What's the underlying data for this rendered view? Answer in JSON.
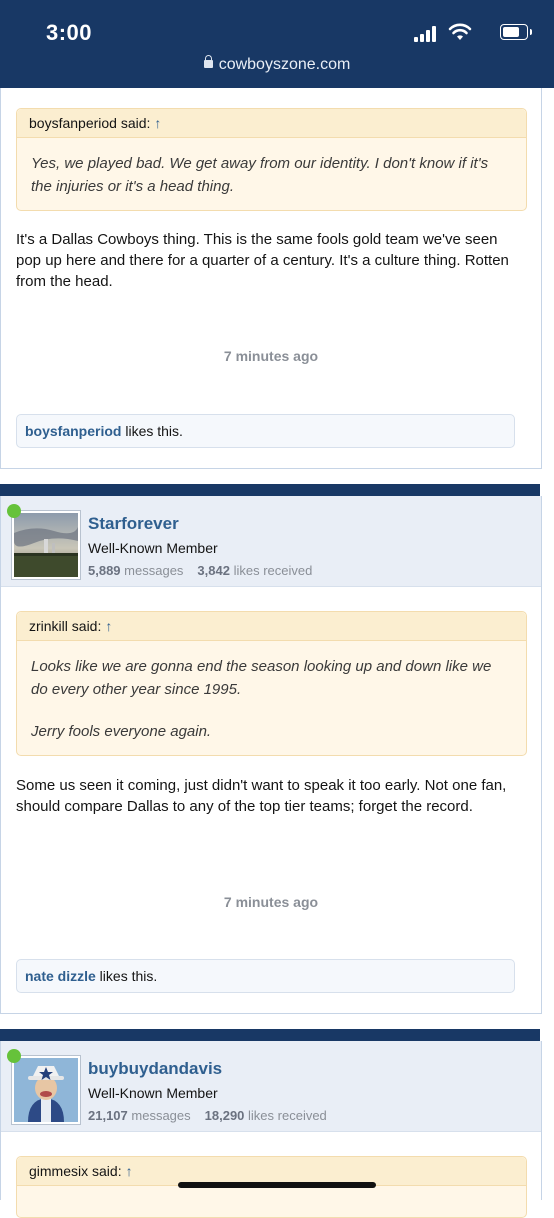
{
  "status": {
    "time": "3:00"
  },
  "browser": {
    "url": "cowboyszone.com"
  },
  "posts": [
    {
      "quote": {
        "author_said": "boysfanperiod said:",
        "arrow": "↑",
        "paragraphs": [
          "Yes, we played bad. We get away from our identity. I don't know if it's the injuries or it's a head thing."
        ]
      },
      "body": "It's a Dallas Cowboys thing. This is the same fools gold team we've seen pop up here and there for a quarter of a century. It's a culture thing. Rotten from the head.",
      "time": "7 minutes ago",
      "likes": {
        "liker": "boysfanperiod",
        "suffix": " likes this."
      }
    },
    {
      "author": {
        "name": "Starforever",
        "title": "Well-Known Member",
        "messages_count": "5,889",
        "messages_label": "messages",
        "likes_count": "3,842",
        "likes_label": "likes received"
      },
      "quote": {
        "author_said": "zrinkill said:",
        "arrow": "↑",
        "paragraphs": [
          "Looks like we are gonna end the season looking up and down like we do every other year since 1995.",
          "Jerry fools everyone again."
        ]
      },
      "body": "Some us seen it coming, just didn't want to speak it too early. Not one fan, should compare Dallas to any of the top tier teams; forget the record.",
      "time": "7 minutes ago",
      "likes": {
        "liker": "nate dizzle",
        "suffix": " likes this."
      }
    },
    {
      "author": {
        "name": "buybuydandavis",
        "title": "Well-Known Member",
        "messages_count": "21,107",
        "messages_label": "messages",
        "likes_count": "18,290",
        "likes_label": "likes received"
      },
      "quote": {
        "author_said": "gimmesix said:",
        "arrow": "↑"
      }
    }
  ],
  "colors": {
    "header_bg": "#183865",
    "username": "#2f5f8f",
    "quote_bg": "#fff7e8",
    "online": "#66c23a"
  }
}
